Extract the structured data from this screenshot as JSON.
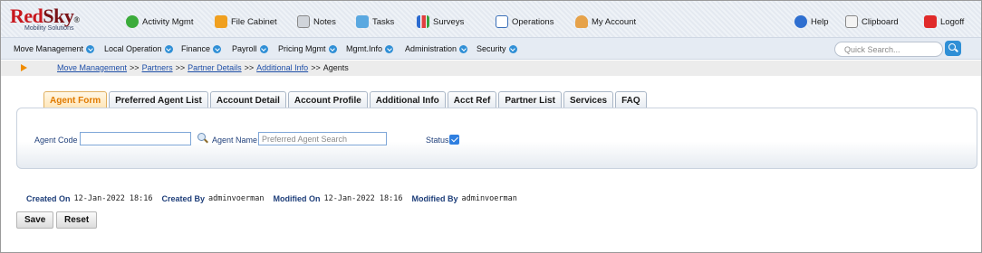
{
  "logo": {
    "name_red": "Red",
    "name_dark": "Sky",
    "trademark": "®",
    "tagline": "Mobility Solutions"
  },
  "top_nav": [
    {
      "label": "Activity Mgmt",
      "icon": "gear-icon"
    },
    {
      "label": "File Cabinet",
      "icon": "folder-icon"
    },
    {
      "label": "Notes",
      "icon": "pencil-icon"
    },
    {
      "label": "Tasks",
      "icon": "tasks-icon"
    },
    {
      "label": "Surveys",
      "icon": "bar-chart-icon"
    },
    {
      "label": "Operations",
      "icon": "calendar-icon"
    },
    {
      "label": "My Account",
      "icon": "user-icon"
    },
    {
      "label": "Help",
      "icon": "help-icon"
    },
    {
      "label": "Clipboard",
      "icon": "clipboard-icon"
    },
    {
      "label": "Logoff",
      "icon": "power-icon"
    }
  ],
  "menu": [
    "Move Management",
    "Local Operation",
    "Finance",
    "Payroll",
    "Pricing Mgmt",
    "Mgmt.Info",
    "Administration",
    "Security"
  ],
  "quick_search": {
    "placeholder": "Quick Search..."
  },
  "breadcrumb": {
    "links": [
      "Move Management",
      "Partners",
      "Partner Details",
      "Additional Info"
    ],
    "separator": ">>",
    "current": "Agents"
  },
  "tabs": [
    {
      "label": "Agent Form",
      "active": true
    },
    {
      "label": "Preferred Agent List",
      "active": false
    },
    {
      "label": "Account Detail",
      "active": false
    },
    {
      "label": "Account Profile",
      "active": false
    },
    {
      "label": "Additional Info",
      "active": false
    },
    {
      "label": "Acct Ref",
      "active": false
    },
    {
      "label": "Partner List",
      "active": false
    },
    {
      "label": "Services",
      "active": false
    },
    {
      "label": "FAQ",
      "active": false
    }
  ],
  "form": {
    "agent_code_label": "Agent Code",
    "agent_code_value": "",
    "agent_name_label": "Agent Name",
    "agent_name_placeholder": "Preferred Agent Search",
    "status_label": "Status",
    "status_checked": true
  },
  "audit": {
    "created_on_label": "Created On",
    "created_on": "12-Jan-2022 18:16",
    "created_by_label": "Created By",
    "created_by": "adminvoerman",
    "modified_on_label": "Modified On",
    "modified_on": "12-Jan-2022 18:16",
    "modified_by_label": "Modified By",
    "modified_by": "adminvoerman"
  },
  "buttons": {
    "save": "Save",
    "reset": "Reset"
  },
  "colors": {
    "accent": "#2f8fd6",
    "active_tab": "#e07a00",
    "logo_red": "#c8181e",
    "link": "#1f4fa8"
  }
}
